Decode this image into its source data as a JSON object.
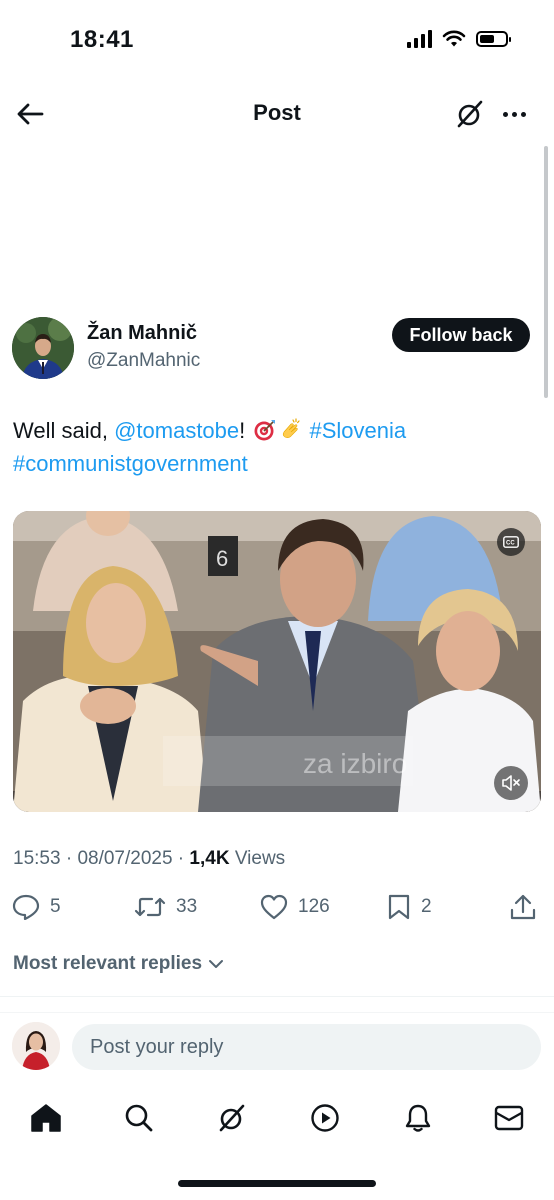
{
  "status_bar": {
    "time": "18:41"
  },
  "header": {
    "title": "Post",
    "back_icon": "arrow-left-icon",
    "grok_icon": "grok-icon",
    "more_icon": "more-icon"
  },
  "author": {
    "name": "Žan Mahnič",
    "handle": "@ZanMahnic",
    "follow_label": "Follow back"
  },
  "tweet": {
    "text_start": "Well said, ",
    "mention": "@tomastobe",
    "text_mid": "! ",
    "emojis": [
      "direct-hit-icon",
      "clapping-hands-icon"
    ],
    "hashtag1": "#Slovenia",
    "hashtag2": "#communistgovernment"
  },
  "media": {
    "caption_watermark": "za izbiro",
    "cc_label": "CC",
    "seat_number": "6"
  },
  "meta": {
    "time": "15:53",
    "sep1": " · ",
    "date": "08/07/2025",
    "sep2": " · ",
    "views_count": "1,4K",
    "views_label": " Views"
  },
  "actions": {
    "replies": "5",
    "reposts": "33",
    "likes": "126",
    "bookmarks": "2"
  },
  "replies_sort": {
    "label": "Most relevant replies"
  },
  "reply_bar": {
    "placeholder": "Post your reply"
  },
  "tab_bar": [
    "home-icon",
    "search-icon",
    "grok-icon",
    "video-icon",
    "notifications-icon",
    "messages-icon"
  ],
  "colors": {
    "accent": "#1d9bf0",
    "text": "#0f1419",
    "secondary": "#536471"
  }
}
